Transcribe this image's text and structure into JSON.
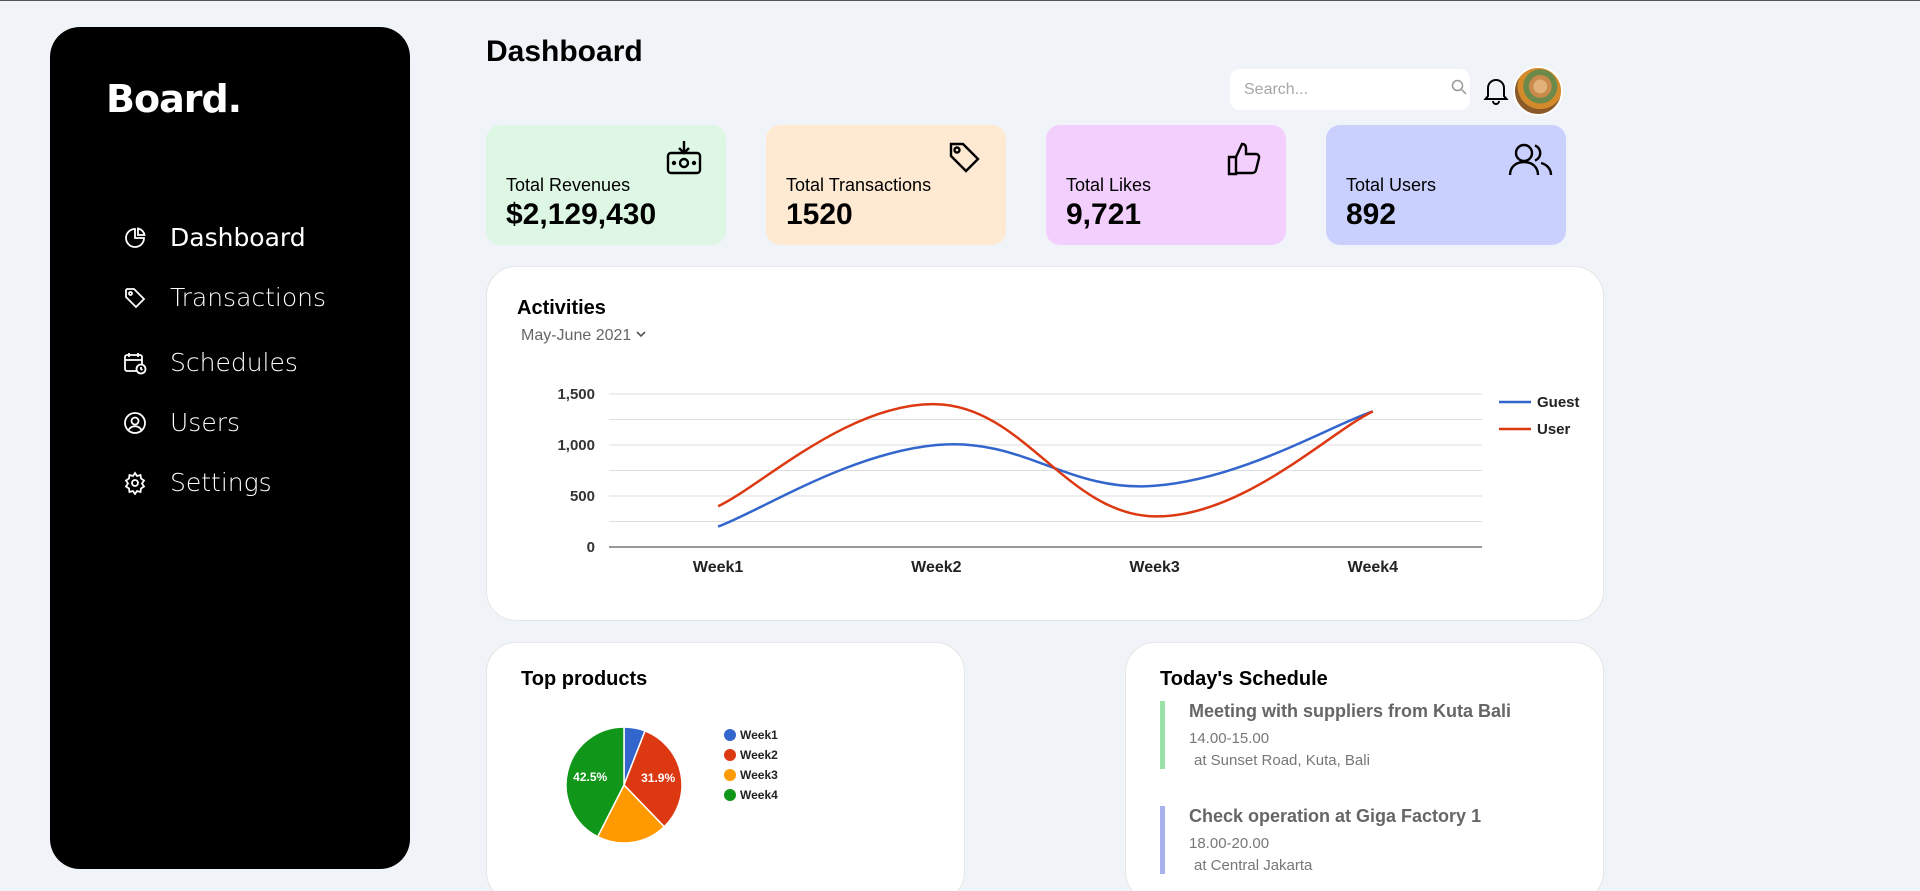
{
  "sidebar": {
    "brand": "Board.",
    "items": [
      {
        "label": "Dashboard",
        "icon": "pie-chart-icon"
      },
      {
        "label": "Transactions",
        "icon": "tag-icon"
      },
      {
        "label": "Schedules",
        "icon": "calendar-clock-icon"
      },
      {
        "label": "Users",
        "icon": "user-circle-icon"
      },
      {
        "label": "Settings",
        "icon": "gear-icon"
      }
    ]
  },
  "header": {
    "title": "Dashboard",
    "search_placeholder": "Search..."
  },
  "cards": [
    {
      "label": "Total Revenues",
      "value": "$2,129,430",
      "color": "#ddf7e4",
      "icon": "money-download-icon"
    },
    {
      "label": "Total Transactions",
      "value": "1520",
      "color": "#feead3",
      "icon": "tag-icon"
    },
    {
      "label": "Total Likes",
      "value": "9,721",
      "color": "#f3cffe",
      "icon": "thumbs-up-icon"
    },
    {
      "label": "Total Users",
      "value": "892",
      "color": "#c9d0fe",
      "icon": "users-icon"
    }
  ],
  "activities": {
    "title": "Activities",
    "range": "May-June 2021"
  },
  "chart_data": [
    {
      "type": "line",
      "categories": [
        "Week1",
        "Week2",
        "Week3",
        "Week4"
      ],
      "series": [
        {
          "name": "Guest",
          "values": [
            200,
            1000,
            600,
            1330
          ],
          "color": "#3366cc"
        },
        {
          "name": "User",
          "values": [
            400,
            1400,
            300,
            1330
          ],
          "color": "#dc3912"
        }
      ],
      "ylim": [
        0,
        1500
      ],
      "yticks": [
        "0",
        "500",
        "1,000",
        "1,500"
      ],
      "grid": true,
      "legend": "right"
    },
    {
      "type": "pie",
      "title": "Top products",
      "slices": [
        {
          "label": "Week1",
          "value": 5.9,
          "color": "#3366cc"
        },
        {
          "label": "Week2",
          "value": 31.9,
          "color": "#dc3912",
          "display": "31.9%"
        },
        {
          "label": "Week3",
          "value": 19.7,
          "color": "#ff9900"
        },
        {
          "label": "Week4",
          "value": 42.5,
          "color": "#109618",
          "display": "42.5%"
        }
      ],
      "legend": "right"
    }
  ],
  "top_products": {
    "title": "Top products"
  },
  "schedule": {
    "title": "Today's Schedule",
    "items": [
      {
        "title": "Meeting with suppliers from Kuta Bali",
        "time": "14.00-15.00",
        "location": "at Sunset Road, Kuta, Bali",
        "color": "#9be2a9"
      },
      {
        "title": "Check operation at Giga Factory 1",
        "time": "18.00-20.00",
        "location": "at Central Jakarta",
        "color": "#a9b2ef"
      }
    ]
  }
}
